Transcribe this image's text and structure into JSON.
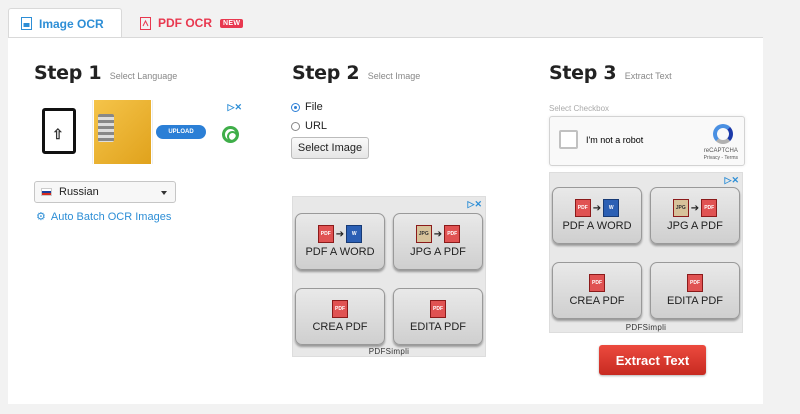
{
  "tabs": [
    {
      "label": "Image OCR",
      "active": true
    },
    {
      "label": "PDF OCR",
      "badge": "NEW",
      "active": false
    }
  ],
  "colors": {
    "accent": "#2d8ed6",
    "pdf_tab": "#e8384f",
    "extract_button": "#d9352b"
  },
  "step1": {
    "title": "Step 1",
    "subtitle": "Select Language",
    "ad_close": "▷✕",
    "upload_label": "UPLOAD",
    "language": {
      "selected": "Russian",
      "flag_icon": "russian-flag-icon"
    },
    "batch_link": "Auto Batch OCR Images"
  },
  "step2": {
    "title": "Step 2",
    "subtitle": "Select Image",
    "options": [
      {
        "label": "File",
        "selected": true
      },
      {
        "label": "URL",
        "selected": false
      }
    ],
    "select_button": "Select Image",
    "ad": {
      "close": "▷✕",
      "buttons": [
        "PDF A WORD",
        "JPG A PDF",
        "CREA PDF",
        "EDITA PDF"
      ],
      "brand": "PDFSimpli"
    }
  },
  "step3": {
    "title": "Step 3",
    "subtitle": "Extract Text",
    "checkbox_label": "Select Checkbox",
    "captcha": {
      "text": "I'm not a robot",
      "brand": "reCAPTCHA",
      "links": "Privacy - Terms"
    },
    "ad": {
      "close": "▷✕",
      "buttons": [
        "PDF A WORD",
        "JPG A PDF",
        "CREA PDF",
        "EDITA PDF"
      ],
      "brand": "PDFSimpli"
    },
    "extract_button": "Extract Text"
  },
  "ad_icons": {
    "pdf": "PDF",
    "jpg": "JPG",
    "word": "W"
  }
}
